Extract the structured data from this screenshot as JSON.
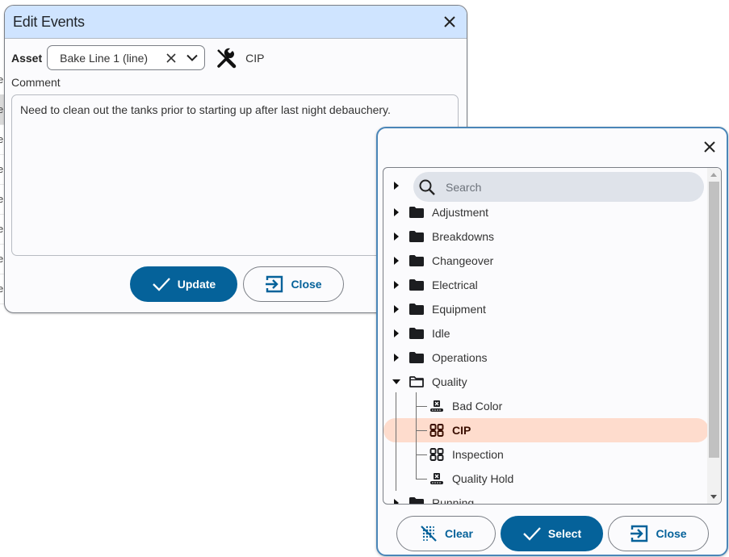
{
  "background": {
    "row_fragments": [
      "e",
      "e",
      "e",
      "e",
      "e",
      "e",
      "e",
      "e"
    ]
  },
  "edit_dialog": {
    "title": "Edit Events",
    "asset_label": "Asset",
    "asset_value": "Bake Line 1 (line)",
    "event_icon": "tools-icon",
    "event_label": "CIP",
    "comment_label": "Comment",
    "comment_value": "Need to clean out the tanks prior to starting up after last night debauchery.",
    "update_label": "Update",
    "close_label": "Close"
  },
  "picker_dialog": {
    "search_placeholder": "Search",
    "tree": [
      {
        "label": "Adjustment",
        "expanded": false
      },
      {
        "label": "Breakdowns",
        "expanded": false
      },
      {
        "label": "Changeover",
        "expanded": false
      },
      {
        "label": "Electrical",
        "expanded": false
      },
      {
        "label": "Equipment",
        "expanded": false
      },
      {
        "label": "Idle",
        "expanded": false
      },
      {
        "label": "Operations",
        "expanded": false
      },
      {
        "label": "Quality",
        "expanded": true,
        "children": [
          {
            "label": "Bad Color",
            "icon": "conveyor-stop-icon",
            "selected": false
          },
          {
            "label": "CIP",
            "icon": "grid-icon",
            "selected": true
          },
          {
            "label": "Inspection",
            "icon": "grid-icon",
            "selected": false
          },
          {
            "label": "Quality Hold",
            "icon": "conveyor-stop-icon",
            "selected": false
          }
        ]
      },
      {
        "label": "Running",
        "expanded": false
      }
    ],
    "clear_label": "Clear",
    "select_label": "Select",
    "close_label": "Close"
  },
  "colors": {
    "primary": "#05629a",
    "header_bg": "#cfe4ff",
    "selected_bg": "#fedccd",
    "picker_border": "#4a86b8"
  }
}
